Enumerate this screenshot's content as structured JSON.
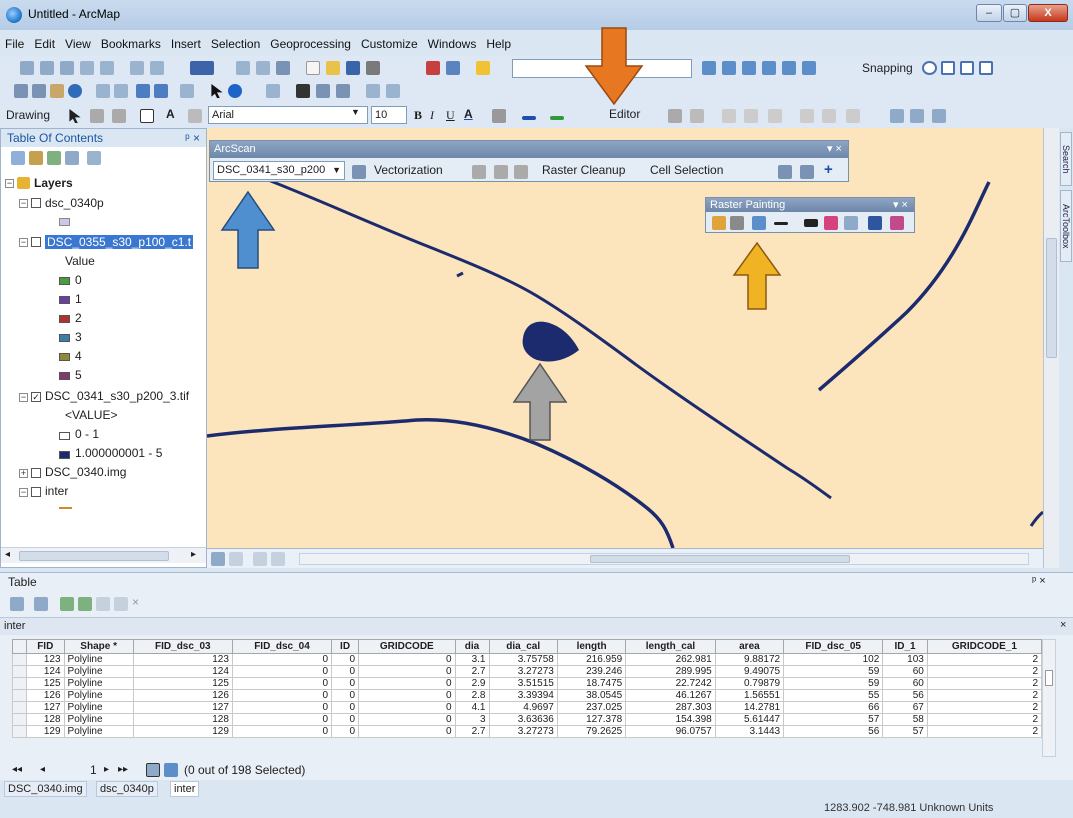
{
  "window": {
    "title": "Untitled - ArcMap"
  },
  "menu": [
    "File",
    "Edit",
    "View",
    "Bookmarks",
    "Insert",
    "Selection",
    "Geoprocessing",
    "Customize",
    "Windows",
    "Help"
  ],
  "toolbar": {
    "snapping_label": "Snapping",
    "editor_label": "Editor",
    "drawing_label": "Drawing",
    "font_name": "Arial",
    "font_size": "10",
    "bold": "B",
    "italic": "I",
    "underline": "U",
    "text_color": "A"
  },
  "toc": {
    "title": "Table Of Contents",
    "layers_label": "Layers",
    "items": [
      {
        "name": "dsc_0340p"
      },
      {
        "name": "DSC_0355_s30_p100_c1.t"
      },
      {
        "name": "Value"
      },
      {
        "name": "DSC_0341_s30_p200_3.tif"
      },
      {
        "name": "<VALUE>"
      },
      {
        "name": "0 - 1"
      },
      {
        "name": "1.000000001 - 5"
      },
      {
        "name": "DSC_0340.img"
      },
      {
        "name": "inter"
      }
    ],
    "legend_values": [
      {
        "label": "0",
        "color": "#4b9b45"
      },
      {
        "label": "1",
        "color": "#6b3fa0"
      },
      {
        "label": "2",
        "color": "#b2322b"
      },
      {
        "label": "3",
        "color": "#3b7fa8"
      },
      {
        "label": "4",
        "color": "#8f8a3a"
      },
      {
        "label": "5",
        "color": "#7e3a6e"
      }
    ]
  },
  "arcscan": {
    "title": "ArcScan",
    "layer_combo": "DSC_0341_s30_p200",
    "vectorization": "Vectorization",
    "raster_cleanup": "Raster Cleanup",
    "cell_selection": "Cell Selection"
  },
  "raster_painting": {
    "title": "Raster Painting"
  },
  "map": {
    "background": "#fce5bd",
    "feature_color": "#1c2b6e"
  },
  "arrows": {
    "orange": "#e87722",
    "blue": "#4f8fd0",
    "yellow": "#f0b323",
    "gray": "#a3a3a3"
  },
  "table": {
    "title": "Table",
    "layer_tab": "inter",
    "columns": [
      "FID",
      "Shape *",
      "FID_dsc_03",
      "FID_dsc_04",
      "ID",
      "GRIDCODE",
      "dia",
      "dia_cal",
      "length",
      "length_cal",
      "area",
      "FID_dsc_05",
      "ID_1",
      "GRIDCODE_1"
    ],
    "rows": [
      [
        "123",
        "Polyline",
        "123",
        "0",
        "0",
        "0",
        "3.1",
        "3.75758",
        "216.959",
        "262.981",
        "9.88172",
        "102",
        "103",
        "2"
      ],
      [
        "124",
        "Polyline",
        "124",
        "0",
        "0",
        "0",
        "2.7",
        "3.27273",
        "239.246",
        "289.995",
        "9.49075",
        "59",
        "60",
        "2"
      ],
      [
        "125",
        "Polyline",
        "125",
        "0",
        "0",
        "0",
        "2.9",
        "3.51515",
        "18.7475",
        "22.7242",
        "0.79879",
        "59",
        "60",
        "2"
      ],
      [
        "126",
        "Polyline",
        "126",
        "0",
        "0",
        "0",
        "2.8",
        "3.39394",
        "38.0545",
        "46.1267",
        "1.56551",
        "55",
        "56",
        "2"
      ],
      [
        "127",
        "Polyline",
        "127",
        "0",
        "0",
        "0",
        "4.1",
        "4.9697",
        "237.025",
        "287.303",
        "14.2781",
        "66",
        "67",
        "2"
      ],
      [
        "128",
        "Polyline",
        "128",
        "0",
        "0",
        "0",
        "3",
        "3.63636",
        "127.378",
        "154.398",
        "5.61447",
        "57",
        "58",
        "2"
      ],
      [
        "129",
        "Polyline",
        "129",
        "0",
        "0",
        "0",
        "2.7",
        "3.27273",
        "79.2625",
        "96.0757",
        "3.1443",
        "56",
        "57",
        "2"
      ]
    ],
    "record": "1",
    "selection_text": "(0 out of 198 Selected)",
    "tabs": [
      "DSC_0340.img",
      "dsc_0340p",
      "inter"
    ]
  },
  "status": {
    "coordinates": "1283.902  -748.981 Unknown Units"
  }
}
